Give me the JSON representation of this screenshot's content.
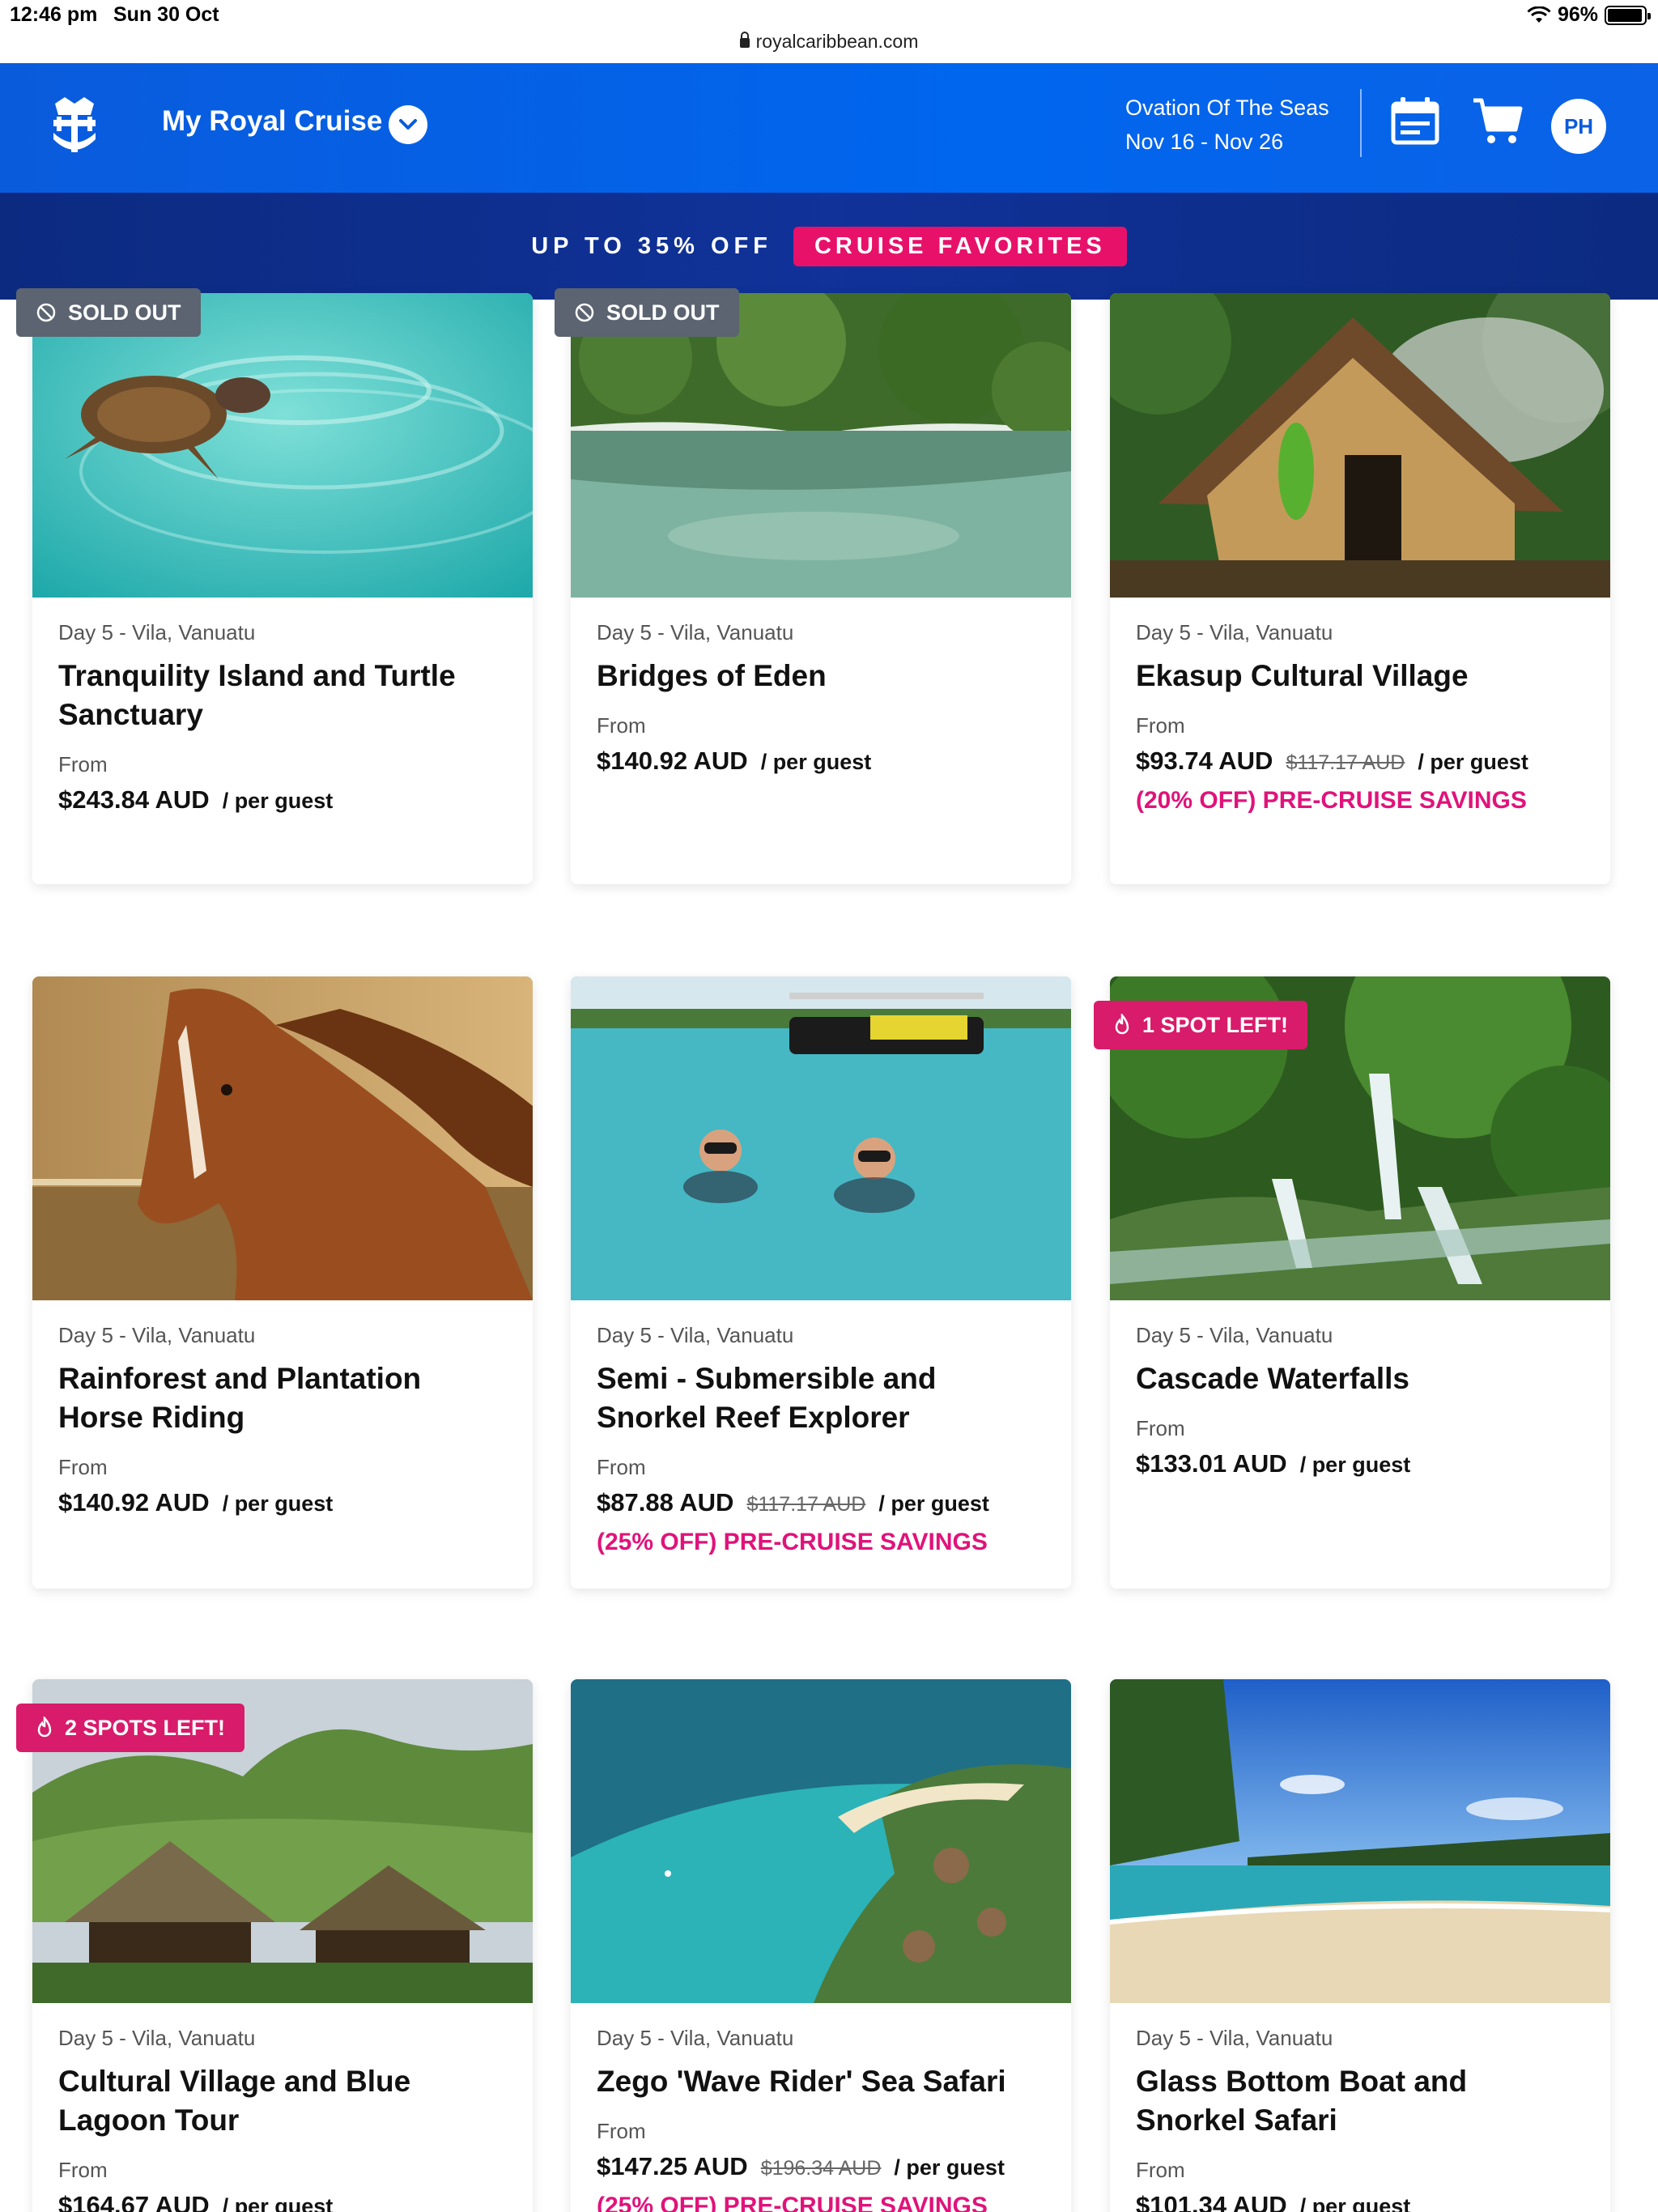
{
  "status_bar": {
    "time": "12:46 pm",
    "date": "Sun 30 Oct",
    "battery": "96%",
    "url": "royalcaribbean.com"
  },
  "header": {
    "title": "My Royal Cruise",
    "ship_name": "Ovation Of The Seas",
    "dates": "Nov 16 - Nov 26",
    "avatar_initials": "PH"
  },
  "promo": {
    "text": "UP TO 35% OFF",
    "button": "CRUISE FAVORITES"
  },
  "cards": [
    {
      "badge": "SOLD OUT",
      "location": "Day 5 - Vila, Vanuatu",
      "title": "Tranquility Island and Turtle Sanctuary",
      "from": "From",
      "price": "$243.84 AUD",
      "original": "",
      "per": "/ per guest",
      "saving": ""
    },
    {
      "badge": "SOLD OUT",
      "location": "Day 5 - Vila, Vanuatu",
      "title": "Bridges of Eden",
      "from": "From",
      "price": "$140.92 AUD",
      "original": "",
      "per": "/ per guest",
      "saving": ""
    },
    {
      "badge": "",
      "location": "Day 5 - Vila, Vanuatu",
      "title": "Ekasup Cultural Village",
      "from": "From",
      "price": "$93.74 AUD",
      "original": "$117.17 AUD",
      "per": "/ per guest",
      "saving": "(20% OFF)  PRE-CRUISE SAVINGS"
    },
    {
      "badge": "",
      "location": "Day 5 - Vila, Vanuatu",
      "title": "Rainforest and Plantation Horse Riding",
      "from": "From",
      "price": "$140.92 AUD",
      "original": "",
      "per": "/ per guest",
      "saving": ""
    },
    {
      "badge": "",
      "location": "Day 5 - Vila, Vanuatu",
      "title": "Semi - Submersible and Snorkel Reef Explorer",
      "from": "From",
      "price": "$87.88 AUD",
      "original": "$117.17 AUD",
      "per": "/ per guest",
      "saving": "(25% OFF)  PRE-CRUISE SAVINGS"
    },
    {
      "badge": "1 SPOT LEFT!",
      "location": "Day 5 - Vila, Vanuatu",
      "title": "Cascade Waterfalls",
      "from": "From",
      "price": "$133.01 AUD",
      "original": "",
      "per": "/ per guest",
      "saving": ""
    },
    {
      "badge": "2 SPOTS LEFT!",
      "location": "Day 5 - Vila, Vanuatu",
      "title": "Cultural Village and Blue Lagoon Tour",
      "from": "From",
      "price": "$164.67 AUD",
      "original": "",
      "per": "/ per guest",
      "saving": ""
    },
    {
      "badge": "",
      "location": "Day 5 - Vila, Vanuatu",
      "title": "Zego 'Wave Rider' Sea Safari",
      "from": "From",
      "price": "$147.25 AUD",
      "original": "$196.34 AUD",
      "per": "/ per guest",
      "saving": "(25% OFF)  PRE-CRUISE SAVINGS"
    },
    {
      "badge": "",
      "location": "Day 5 - Vila, Vanuatu",
      "title": "Glass Bottom Boat and Snorkel Safari",
      "from": "From",
      "price": "$101.34 AUD",
      "original": "",
      "per": "/ per guest",
      "saving": ""
    }
  ],
  "colors": {
    "header_blue": "#0a5bdc",
    "promo_navy": "#0c2a80",
    "accent_pink": "#e0137a",
    "sold_grey": "#5b6470"
  },
  "icons": [
    "logo-icon",
    "chevron-down-icon",
    "calendar-icon",
    "cart-icon",
    "ban-icon",
    "flame-icon",
    "lock-icon",
    "wifi-icon",
    "battery-icon"
  ]
}
